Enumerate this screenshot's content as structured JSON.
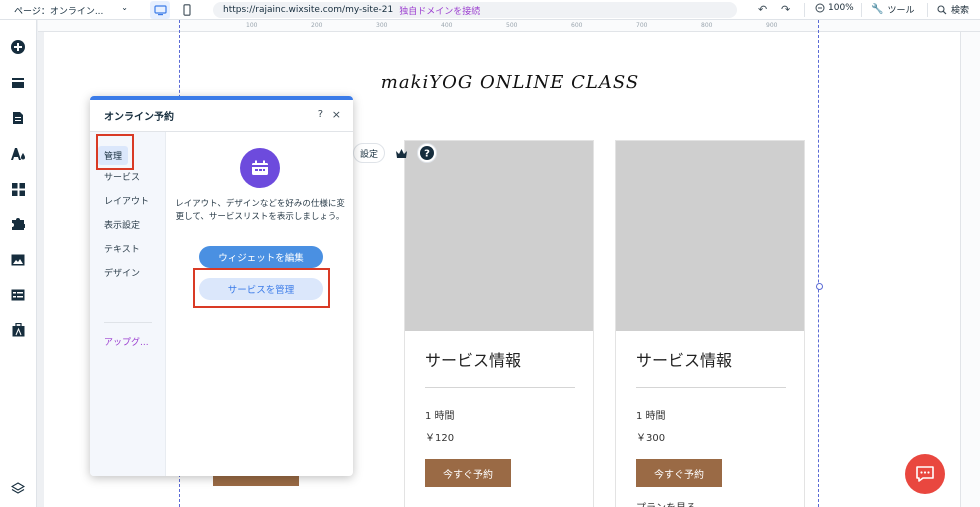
{
  "topbar": {
    "page_label": "ページ：オンライン...",
    "url": "https://rajainc.wixsite.com/my-site-21",
    "connect_domain": "独自ドメインを接続",
    "zoom": "100%",
    "tools_label": "ツール",
    "search_label": "検索"
  },
  "ruler": {
    "marks": [
      "100",
      "200",
      "300",
      "400",
      "500",
      "600",
      "700",
      "800",
      "900"
    ]
  },
  "site": {
    "title": "makiYOG ONLINE CLASS",
    "settings_label": "設定",
    "cards": [
      {
        "name": "サービス情報",
        "duration": "1 時間",
        "price": "￥120",
        "book": "今すぐ予約"
      },
      {
        "name": "サービス情報",
        "duration": "1 時間",
        "price": "￥300",
        "book": "今すぐ予約",
        "plans": "プランを見る"
      }
    ]
  },
  "panel": {
    "title": "オンライン予約",
    "help": "?",
    "close": "×",
    "nav": [
      "管理",
      "サービス",
      "レイアウト",
      "表示設定",
      "テキスト",
      "デザイン"
    ],
    "upgrade": "アップグ...",
    "description": "レイアウト、デザインなどを好みの仕様に変更して、サービスリストを表示しましょう。",
    "edit_widget": "ウィジェットを編集",
    "manage_services": "サービスを管理"
  },
  "colors": {
    "accent": "#3b7be8",
    "book_button": "#9a6a45",
    "highlight": "#d93a25",
    "chat": "#e9473f"
  }
}
